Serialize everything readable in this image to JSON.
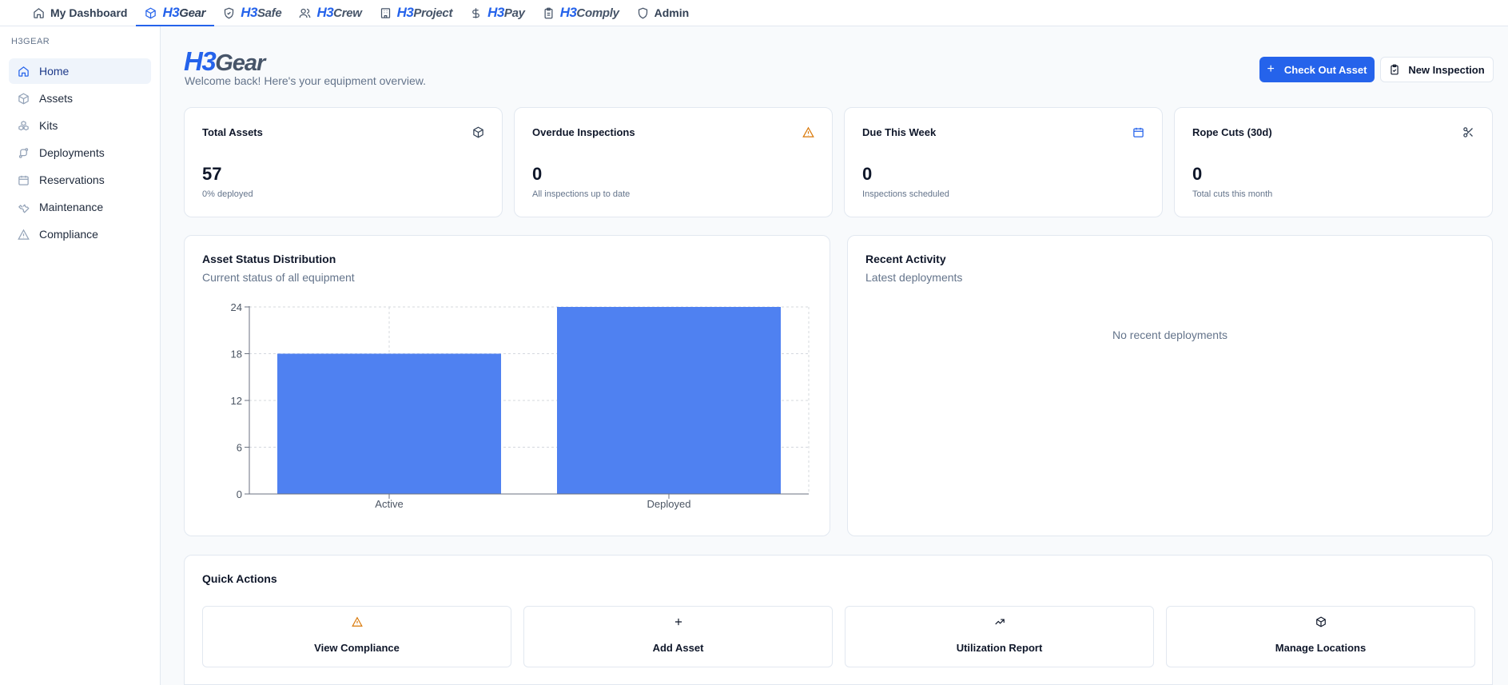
{
  "topnav": {
    "tabs": [
      {
        "label": "My Dashboard",
        "icon": "home-icon"
      },
      {
        "brand_prefix": "H3",
        "brand_rest": "Gear",
        "icon": "cube-icon",
        "active": true
      },
      {
        "brand_prefix": "H3",
        "brand_rest": "Safe",
        "icon": "shield-check-icon"
      },
      {
        "brand_prefix": "H3",
        "brand_rest": "Crew",
        "icon": "users-icon"
      },
      {
        "brand_prefix": "H3",
        "brand_rest": "Project",
        "icon": "building-icon"
      },
      {
        "brand_prefix": "H3",
        "brand_rest": "Pay",
        "icon": "dollar-icon"
      },
      {
        "brand_prefix": "H3",
        "brand_rest": "Comply",
        "icon": "clipboard-icon"
      },
      {
        "label": "Admin",
        "icon": "shield-icon"
      }
    ]
  },
  "sidebar": {
    "heading": "H3GEAR",
    "items": [
      {
        "label": "Home",
        "icon": "home-icon",
        "active": true
      },
      {
        "label": "Assets",
        "icon": "cube-icon"
      },
      {
        "label": "Kits",
        "icon": "boxes-icon"
      },
      {
        "label": "Deployments",
        "icon": "route-icon"
      },
      {
        "label": "Reservations",
        "icon": "calendar-icon"
      },
      {
        "label": "Maintenance",
        "icon": "wrench-icon"
      },
      {
        "label": "Compliance",
        "icon": "warning-icon"
      }
    ]
  },
  "header": {
    "logo_prefix": "H3",
    "logo_rest": "Gear",
    "welcome": "Welcome back! Here's your equipment overview.",
    "check_out_label": "Check Out Asset",
    "new_inspection_label": "New Inspection"
  },
  "stats": [
    {
      "title": "Total Assets",
      "value": "57",
      "sub": "0% deployed",
      "icon": "cube-icon"
    },
    {
      "title": "Overdue Inspections",
      "value": "0",
      "sub": "All inspections up to date",
      "icon": "warning-icon"
    },
    {
      "title": "Due This Week",
      "value": "0",
      "sub": "Inspections scheduled",
      "icon": "calendar-icon"
    },
    {
      "title": "Rope Cuts (30d)",
      "value": "0",
      "sub": "Total cuts this month",
      "icon": "scissors-icon"
    }
  ],
  "status_chart": {
    "title": "Asset Status Distribution",
    "subtitle": "Current status of all equipment"
  },
  "chart_data": {
    "type": "bar",
    "categories": [
      "Active",
      "Deployed"
    ],
    "values": [
      18,
      24
    ],
    "ylim": [
      0,
      24
    ],
    "yticks": [
      0,
      6,
      12,
      18,
      24
    ],
    "grid": true,
    "bar_color": "#4f81f1",
    "title": "Asset Status Distribution"
  },
  "recent": {
    "title": "Recent Activity",
    "subtitle": "Latest deployments",
    "empty": "No recent deployments"
  },
  "quick_actions": {
    "title": "Quick Actions",
    "items": [
      {
        "label": "View Compliance",
        "icon": "warning-icon"
      },
      {
        "label": "Add Asset",
        "icon": "plus-icon"
      },
      {
        "label": "Utilization Report",
        "icon": "trending-up-icon"
      },
      {
        "label": "Manage Locations",
        "icon": "cube-icon"
      }
    ]
  },
  "colors": {
    "accent": "#2563eb",
    "warning": "#d97706",
    "bar": "#4f81f1"
  }
}
